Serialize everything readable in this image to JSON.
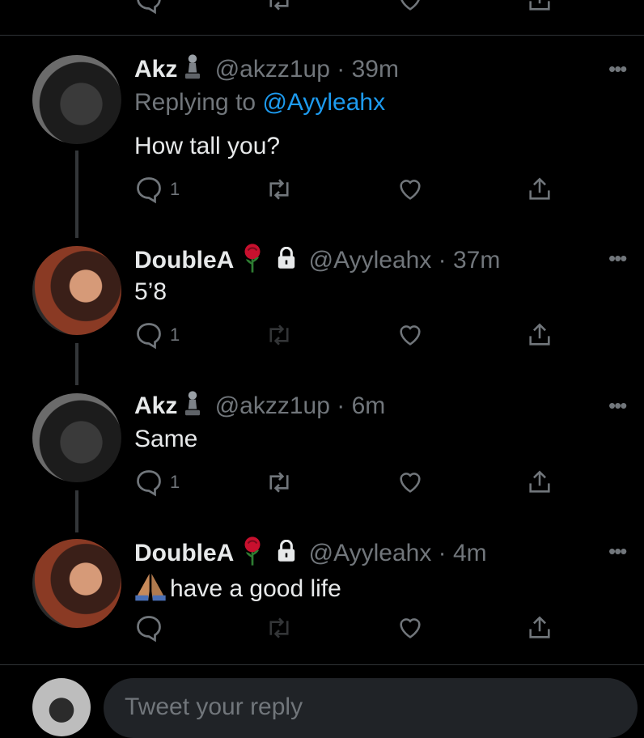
{
  "tweets": [
    {
      "name": "Akz",
      "handle": "@akzz1up",
      "time": "39m",
      "replying_prefix": "Replying to",
      "replying_to": "@Ayyleahx",
      "text": "How tall you?",
      "reply_count": "1",
      "name_emoji": "chess-pawn-icon"
    },
    {
      "name": "DoubleA",
      "handle": "@Ayyleahx",
      "time": "37m",
      "text": "5’8",
      "reply_count": "1",
      "name_emoji": "rose-icon",
      "protected": true
    },
    {
      "name": "Akz",
      "handle": "@akzz1up",
      "time": "6m",
      "text": "Same",
      "reply_count": "1",
      "name_emoji": "chess-pawn-icon"
    },
    {
      "name": "DoubleA",
      "handle": "@Ayyleahx",
      "time": "4m",
      "text": "have a good life",
      "text_emoji": "folded-hands-icon",
      "reply_count": "",
      "name_emoji": "rose-icon",
      "protected": true
    }
  ],
  "separator": "·",
  "more_label": "•••",
  "compose": {
    "placeholder": "Tweet your reply"
  },
  "colors": {
    "background": "#000000",
    "text": "#e7e9ea",
    "muted": "#71767b",
    "link": "#1d9bf0",
    "divider": "#2f3336"
  }
}
